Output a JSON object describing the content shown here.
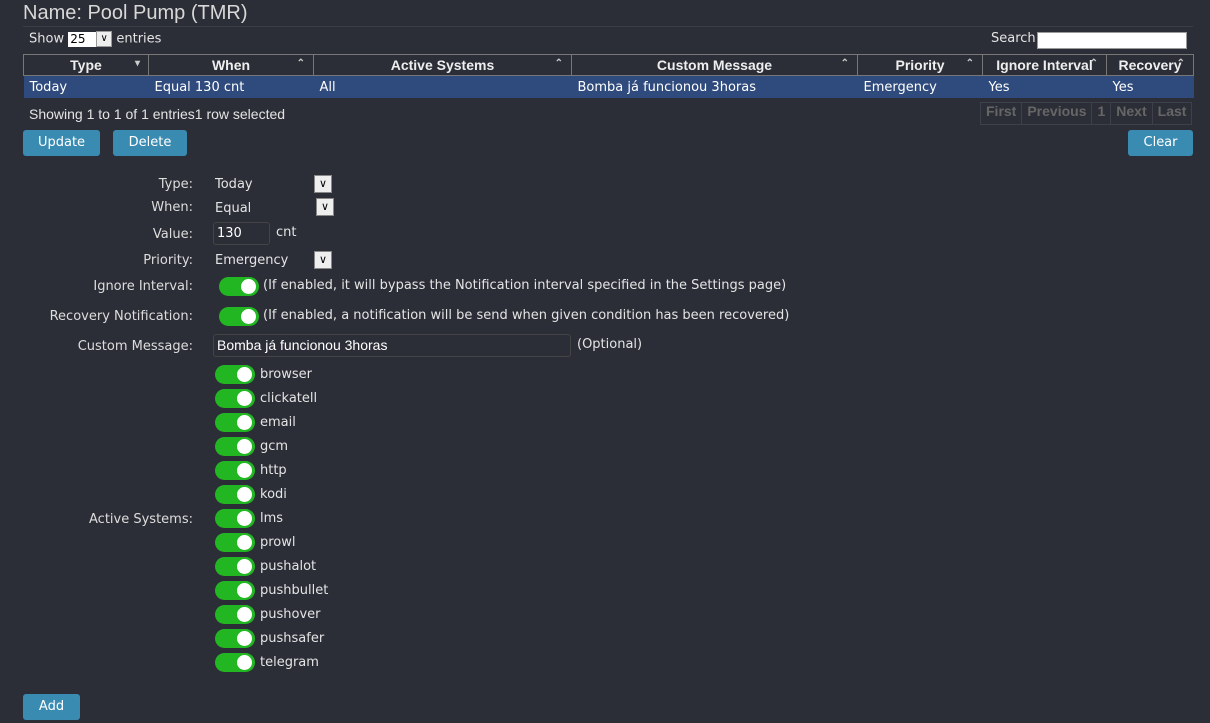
{
  "title": "Name: Pool Pump (TMR)",
  "table_controls": {
    "show": "Show",
    "length": "25",
    "entries": "entries",
    "search_label": "Search:",
    "search_value": ""
  },
  "columns": [
    "Type",
    "When",
    "Active Systems",
    "Custom Message",
    "Priority",
    "Ignore Interval",
    "Recovery"
  ],
  "rows": [
    [
      "Today",
      "Equal 130 cnt",
      "All",
      "Bomba já funcionou 3horas",
      "Emergency",
      "Yes",
      "Yes"
    ]
  ],
  "info": "Showing 1 to 1 of 1 entries1 row selected",
  "pager": [
    "First",
    "Previous",
    "1",
    "Next",
    "Last"
  ],
  "buttons": {
    "update": "Update",
    "delete": "Delete",
    "clear": "Clear",
    "add": "Add"
  },
  "form": {
    "type_label": "Type:",
    "type_value": "Today",
    "when_label": "When:",
    "when_value": "Equal",
    "value_label": "Value:",
    "value_value": "130",
    "value_unit": "cnt",
    "priority_label": "Priority:",
    "priority_value": "Emergency",
    "ignore_label": "Ignore Interval:",
    "ignore_on": true,
    "ignore_hint": "(If enabled, it will bypass the Notification interval specified in the Settings page)",
    "recovery_label": "Recovery Notification:",
    "recovery_on": true,
    "recovery_hint": "(If enabled, a notification will be send when given condition has been recovered)",
    "message_label": "Custom Message:",
    "message_value": "Bomba já funcionou 3horas",
    "message_hint": "(Optional)",
    "systems_label": "Active Systems:",
    "systems": [
      "browser",
      "clickatell",
      "email",
      "gcm",
      "http",
      "kodi",
      "lms",
      "prowl",
      "pushalot",
      "pushbullet",
      "pushover",
      "pushsafer",
      "telegram"
    ]
  },
  "colors": {
    "accent": "#3a8bb2",
    "toggle_on": "#22b722",
    "selected_row": "#2f4a7c",
    "background": "#2b2e37"
  }
}
